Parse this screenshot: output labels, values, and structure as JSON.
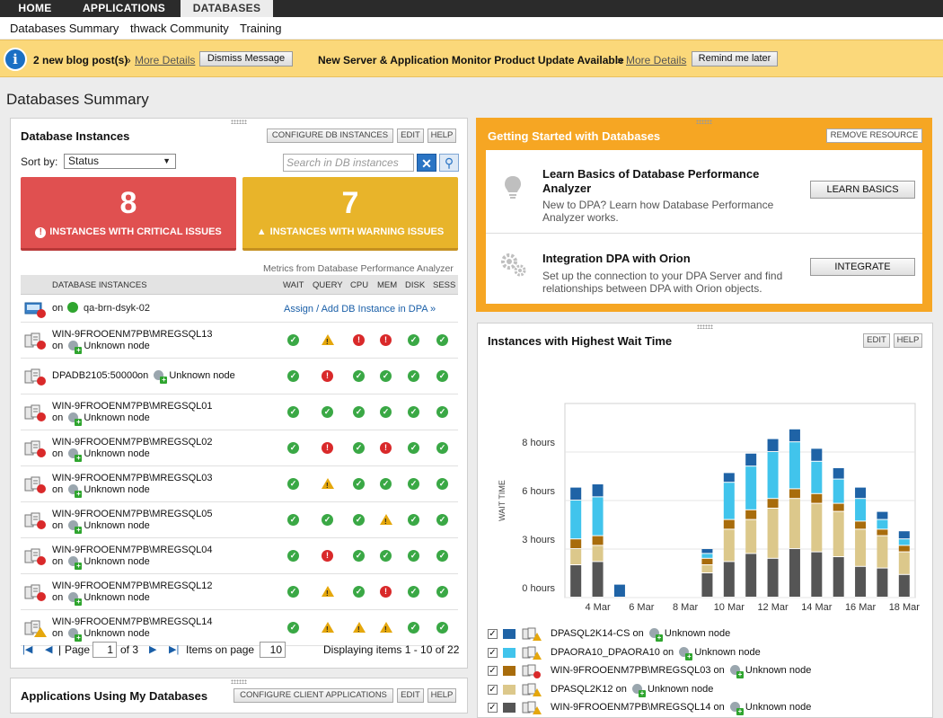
{
  "nav": {
    "tabs": [
      "HOME",
      "APPLICATIONS",
      "DATABASES"
    ],
    "sub": [
      "Databases Summary",
      "thwack Community",
      "Training"
    ]
  },
  "message": {
    "blog": "2 new blog post(s)",
    "blog_link": "More Details",
    "dismiss": "Dismiss Message",
    "update": "New Server & Application Monitor Product Update Available",
    "update_link": "More Details",
    "remind": "Remind me later"
  },
  "page_title": "Databases Summary",
  "instances": {
    "title": "Database Instances",
    "buttons": [
      "CONFIGURE DB INSTANCES",
      "EDIT",
      "HELP"
    ],
    "sort_label": "Sort by:",
    "sort_value": "Status",
    "search_placeholder": "Search in DB instances",
    "critical": {
      "count": "8",
      "label": "INSTANCES WITH CRITICAL ISSUES"
    },
    "warning": {
      "count": "7",
      "label": "INSTANCES WITH WARNING ISSUES"
    },
    "metrics_note": "Metrics from Database Performance Analyzer",
    "columns": [
      "DATABASE INSTANCES",
      "WAIT",
      "QUERY",
      "CPU",
      "MEM",
      "DISK",
      "SESS"
    ],
    "first_row": {
      "on": "on",
      "host": "qa-brn-dsyk-02",
      "action": "Assign / Add DB Instance in DPA »"
    },
    "rows": [
      {
        "name": "WIN-9FROOENM7PB\\MREGSQL13",
        "node": "Unknown node",
        "inline": false,
        "status": [
          "ok",
          "warn",
          "err",
          "err",
          "ok",
          "ok"
        ],
        "warnIcon": false
      },
      {
        "name": "DPADB2105:50000",
        "node": "Unknown node",
        "inline": true,
        "status": [
          "ok",
          "err",
          "ok",
          "ok",
          "ok",
          "ok"
        ],
        "warnIcon": false
      },
      {
        "name": "WIN-9FROOENM7PB\\MREGSQL01",
        "node": "Unknown node",
        "inline": false,
        "status": [
          "ok",
          "ok",
          "ok",
          "ok",
          "ok",
          "ok"
        ],
        "warnIcon": false
      },
      {
        "name": "WIN-9FROOENM7PB\\MREGSQL02",
        "node": "Unknown node",
        "inline": false,
        "status": [
          "ok",
          "err",
          "ok",
          "err",
          "ok",
          "ok"
        ],
        "warnIcon": false
      },
      {
        "name": "WIN-9FROOENM7PB\\MREGSQL03",
        "node": "Unknown node",
        "inline": false,
        "status": [
          "ok",
          "warn",
          "ok",
          "ok",
          "ok",
          "ok"
        ],
        "warnIcon": false
      },
      {
        "name": "WIN-9FROOENM7PB\\MREGSQL05",
        "node": "Unknown node",
        "inline": false,
        "status": [
          "ok",
          "ok",
          "ok",
          "warn",
          "ok",
          "ok"
        ],
        "warnIcon": false
      },
      {
        "name": "WIN-9FROOENM7PB\\MREGSQL04",
        "node": "Unknown node",
        "inline": false,
        "status": [
          "ok",
          "err",
          "ok",
          "ok",
          "ok",
          "ok"
        ],
        "warnIcon": false
      },
      {
        "name": "WIN-9FROOENM7PB\\MREGSQL12",
        "node": "Unknown node",
        "inline": false,
        "status": [
          "ok",
          "warn",
          "ok",
          "err",
          "ok",
          "ok"
        ],
        "warnIcon": false
      },
      {
        "name": "WIN-9FROOENM7PB\\MREGSQL14",
        "node": "Unknown node",
        "inline": false,
        "status": [
          "ok",
          "warn",
          "warn",
          "warn",
          "ok",
          "ok"
        ],
        "warnIcon": true
      }
    ],
    "pager": {
      "page_label": "Page",
      "page": "1",
      "of": "of 3",
      "items_label": "Items on page",
      "items": "10",
      "display": "Displaying items 1 - 10 of 22"
    }
  },
  "apps": {
    "title": "Applications Using My Databases",
    "buttons": [
      "CONFIGURE CLIENT APPLICATIONS",
      "EDIT",
      "HELP"
    ]
  },
  "getting_started": {
    "title": "Getting Started with Databases",
    "remove": "REMOVE RESOURCE",
    "items": [
      {
        "title": "Learn Basics of Database Performance Analyzer",
        "desc": "New to DPA? Learn how Database Performance Analyzer works.",
        "button": "LEARN BASICS"
      },
      {
        "title": "Integration DPA with Orion",
        "desc": "Set up the connection to your DPA Server and find relationships between DPA with Orion objects.",
        "button": "INTEGRATE"
      }
    ]
  },
  "wait_time": {
    "title": "Instances with Highest Wait Time",
    "buttons": [
      "EDIT",
      "HELP"
    ],
    "legend": [
      {
        "name": "DPASQL2K14-CS",
        "on": "on",
        "node": "Unknown node",
        "color": "#1f63a6",
        "badge": "warn"
      },
      {
        "name": "DPAORA10_DPAORA10",
        "on": "on",
        "node": "Unknown node",
        "color": "#41c4ec",
        "badge": "warn"
      },
      {
        "name": "WIN-9FROOENM7PB\\MREGSQL03",
        "on": "on",
        "node": "Unknown node",
        "color": "#a86c0c",
        "badge": "err"
      },
      {
        "name": "DPASQL2K12",
        "on": "on",
        "node": "Unknown node",
        "color": "#dcc88b",
        "badge": "warn"
      },
      {
        "name": "WIN-9FROOENM7PB\\MREGSQL14",
        "on": "on",
        "node": "Unknown node",
        "color": "#555555",
        "badge": "warn"
      }
    ]
  },
  "chart_data": {
    "type": "bar",
    "stacked": true,
    "ylabel": "WAIT TIME",
    "yticks": [
      "0 hours",
      "3 hours",
      "6 hours",
      "8 hours"
    ],
    "ytick_values": [
      0,
      3,
      6,
      9
    ],
    "ylim": [
      0,
      12
    ],
    "xticks": [
      "4 Mar",
      "6 Mar",
      "8 Mar",
      "10 Mar",
      "12 Mar",
      "14 Mar",
      "16 Mar",
      "18 Mar"
    ],
    "x": [
      "3 Mar",
      "4 Mar",
      "5 Mar",
      "6 Mar",
      "7 Mar",
      "8 Mar",
      "9 Mar",
      "10 Mar",
      "11 Mar",
      "12 Mar",
      "13 Mar",
      "14 Mar",
      "15 Mar",
      "16 Mar",
      "17 Mar",
      "18 Mar"
    ],
    "series": [
      {
        "name": "DPASQL2K14-CS",
        "color": "#1f63a6",
        "values": [
          0.8,
          0.8,
          0.8,
          0,
          0,
          0,
          0.3,
          0.6,
          0.8,
          0.8,
          0.8,
          0.8,
          0.7,
          0.7,
          0.5,
          0.5
        ]
      },
      {
        "name": "DPAORA10_DPAORA10",
        "color": "#41c4ec",
        "values": [
          2.4,
          2.4,
          0,
          0,
          0,
          0,
          0.3,
          2.3,
          2.7,
          2.9,
          2.9,
          2.0,
          1.5,
          1.4,
          0.6,
          0.4
        ]
      },
      {
        "name": "WIN-9FROOENM7PB\\MREGSQL03",
        "color": "#a86c0c",
        "values": [
          0.6,
          0.6,
          0,
          0,
          0,
          0,
          0.4,
          0.6,
          0.6,
          0.6,
          0.6,
          0.6,
          0.5,
          0.5,
          0.4,
          0.4
        ]
      },
      {
        "name": "DPASQL2K12",
        "color": "#dcc88b",
        "values": [
          1.0,
          1.0,
          0,
          0,
          0,
          0,
          0.5,
          2.0,
          2.1,
          3.1,
          3.1,
          3.0,
          2.8,
          2.3,
          2.0,
          1.4
        ]
      },
      {
        "name": "WIN-9FROOENM7PB\\MREGSQL14",
        "color": "#555555",
        "values": [
          2.0,
          2.2,
          0,
          0,
          0,
          0,
          1.5,
          2.2,
          2.7,
          2.4,
          3.0,
          2.8,
          2.5,
          1.9,
          1.8,
          1.4
        ]
      }
    ]
  }
}
